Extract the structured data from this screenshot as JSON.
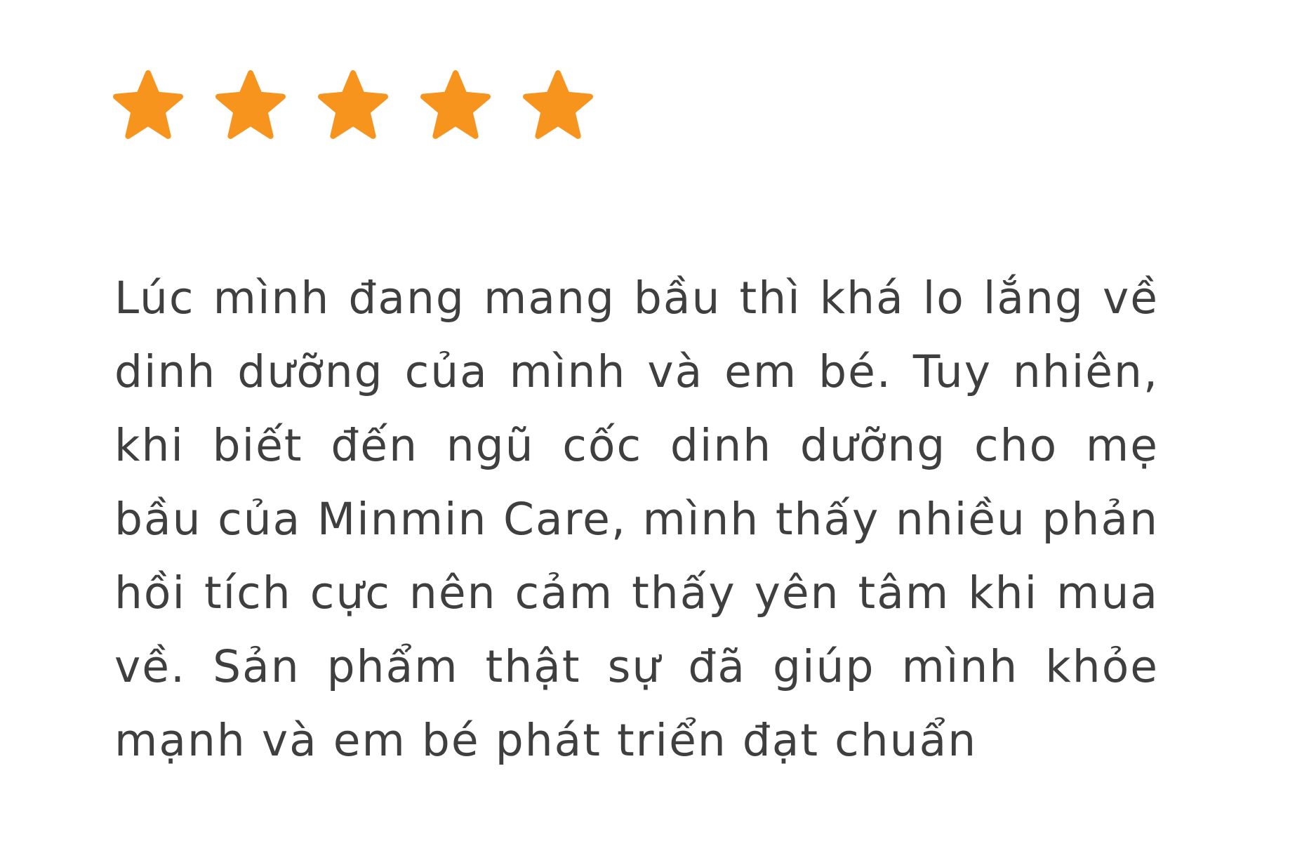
{
  "review": {
    "rating": {
      "value": 5,
      "max": 5,
      "star_color": "#f7941d",
      "icons": [
        "star-icon",
        "star-icon",
        "star-icon",
        "star-icon",
        "star-icon"
      ]
    },
    "text": "Lúc mình đang mang bầu thì khá lo lắng về dinh dưỡng của mình và em bé. Tuy nhiên, khi biết đến ngũ cốc dinh dưỡng cho mẹ bầu của Minmin Care, mình thấy nhiều phản hồi tích cực nên cảm thấy yên tâm khi mua về. Sản phẩm thật sự đã giúp mình khỏe mạnh và em bé phát triển đạt chuẩn"
  }
}
